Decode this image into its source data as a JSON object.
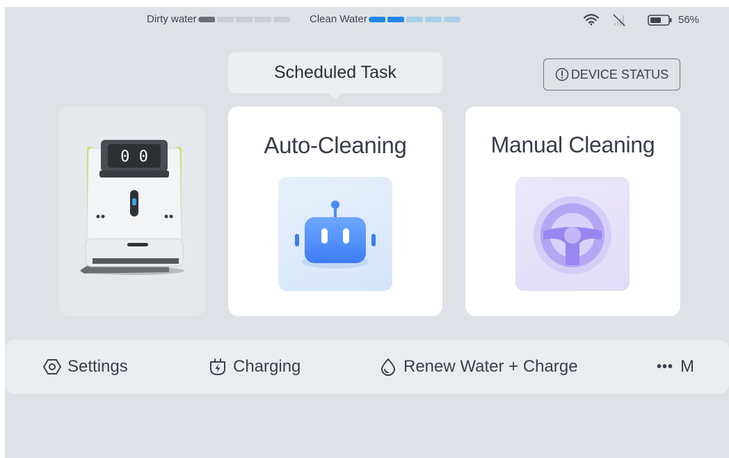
{
  "status_bar": {
    "dirty_water_label": "Dirty water",
    "dirty_water_level": {
      "filled": 1,
      "total": 5
    },
    "clean_water_label": "Clean Water",
    "clean_water_level": {
      "filled": 2,
      "total": 5
    },
    "battery_percent": "56%"
  },
  "header": {
    "scheduled_task_label": "Scheduled Task",
    "device_status_label": "DEVICE STATUS"
  },
  "cards": {
    "auto": {
      "title": "Auto-Cleaning",
      "icon": "robot-face-icon"
    },
    "manual": {
      "title": "Manual Cleaning",
      "icon": "steering-wheel-icon"
    }
  },
  "bottom_bar": {
    "settings_label": "Settings",
    "charging_label": "Charging",
    "renew_label": "Renew Water + Charge",
    "more_dots": "•••",
    "more_label": "M"
  },
  "colors": {
    "background": "#dee1e5",
    "card": "#ffffff",
    "clean_water_accent": "#1e88e5",
    "manual_accent": "#8f7af0"
  }
}
